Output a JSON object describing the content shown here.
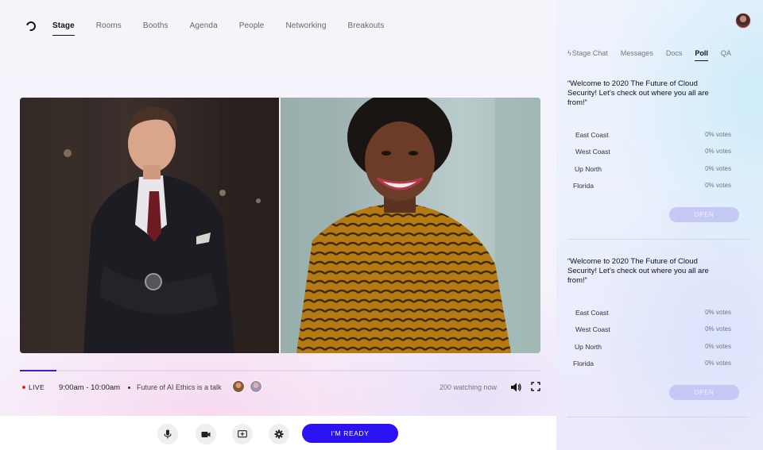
{
  "nav": {
    "items": [
      "Stage",
      "Rooms",
      "Booths",
      "Agenda",
      "People",
      "Networking",
      "Breakouts"
    ],
    "active": "Stage"
  },
  "stream": {
    "live_label": "LIVE",
    "time": "9:00am - 10:00am",
    "session_title": "Future of AI Ethics is a talk",
    "watching": "200 watching now",
    "progress": 0.07
  },
  "toolbar": {
    "ready_label": "I'M READY",
    "icons": [
      "mic-icon",
      "camera-icon",
      "screen-share-icon",
      "gear-icon"
    ]
  },
  "side_tabs": {
    "items": [
      "Stage Chat",
      "Messages",
      "Docs",
      "Poll",
      "QA"
    ],
    "active": "Poll"
  },
  "polls": [
    {
      "question": "“Welcome to 2020 The Future of Cloud Security! Let’s check out where you all are from!”",
      "options": [
        {
          "label": "East Coast",
          "votes": "0% votes"
        },
        {
          "label": "West Coast",
          "votes": "0% votes"
        },
        {
          "label": "Up North",
          "votes": "0% votes"
        },
        {
          "label": "Florida",
          "votes": "0% votes"
        }
      ],
      "button": "OPEN"
    },
    {
      "question": "“Welcome to 2020 The Future of Cloud Security! Let’s check out where you all are from!”",
      "options": [
        {
          "label": "East Coast",
          "votes": "0% votes"
        },
        {
          "label": "West Coast",
          "votes": "0% votes"
        },
        {
          "label": "Up North",
          "votes": "0% votes"
        },
        {
          "label": "Florida",
          "votes": "0% votes"
        }
      ],
      "button": "OPEN"
    }
  ],
  "colors": {
    "accent": "#2b12f2",
    "live_dot": "#e02a2a",
    "open_button": "#c6c9f6"
  }
}
